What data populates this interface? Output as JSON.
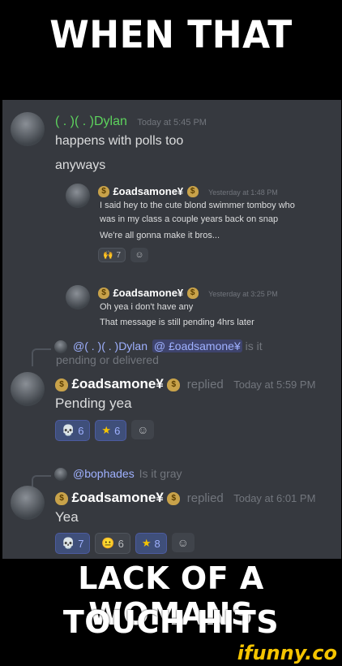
{
  "captions": {
    "top": "WHEN THAT",
    "bottom_line1": "LACK OF A WOMANS",
    "bottom_line2": "TOUCH HITS"
  },
  "watermark": "ifunny.co",
  "messages": [
    {
      "author": "( . )( . )Dylan",
      "timestamp": "Today at 5:45 PM",
      "lines": [
        "happens with polls too",
        "anyways"
      ],
      "name_color": "#5dd35d"
    }
  ],
  "embedded": [
    {
      "author": "£oadsamone¥",
      "timestamp": "Yesterday at 1:48 PM",
      "lines": [
        "I said hey to the cute blond swimmer tomboy who",
        "was in my class a couple years back on snap",
        "We're all gonna make it bros..."
      ],
      "reaction_count": "7"
    },
    {
      "author": "£oadsamone¥",
      "timestamp": "Yesterday at 3:25 PM",
      "lines": [
        "Oh yea i don't have any",
        "That message is still pending 4hrs later"
      ]
    }
  ],
  "replies": [
    {
      "reply_author": "@( . )( . )Dylan",
      "reply_mention": "@ £oadsamone¥",
      "reply_text_a": "is it",
      "reply_text_b": "pending or delivered",
      "author": "£oadsamone¥",
      "replied_label": "replied",
      "timestamp": "Today at 5:59 PM",
      "text": "Pending yea",
      "reactions": [
        {
          "icon": "skull-emoji",
          "glyph": "💀",
          "count": "6"
        },
        {
          "icon": "star-emoji",
          "glyph": "★",
          "count": "6"
        }
      ]
    },
    {
      "reply_author": "@bophades",
      "reply_text": "Is it gray",
      "author": "£oadsamone¥",
      "replied_label": "replied",
      "timestamp": "Today at 6:01 PM",
      "text": "Yea",
      "reactions": [
        {
          "icon": "skull-emoji",
          "glyph": "💀",
          "count": "7"
        },
        {
          "icon": "face-emoji",
          "glyph": "😐",
          "count": "6"
        },
        {
          "icon": "star-emoji",
          "glyph": "★",
          "count": "8"
        }
      ]
    }
  ]
}
